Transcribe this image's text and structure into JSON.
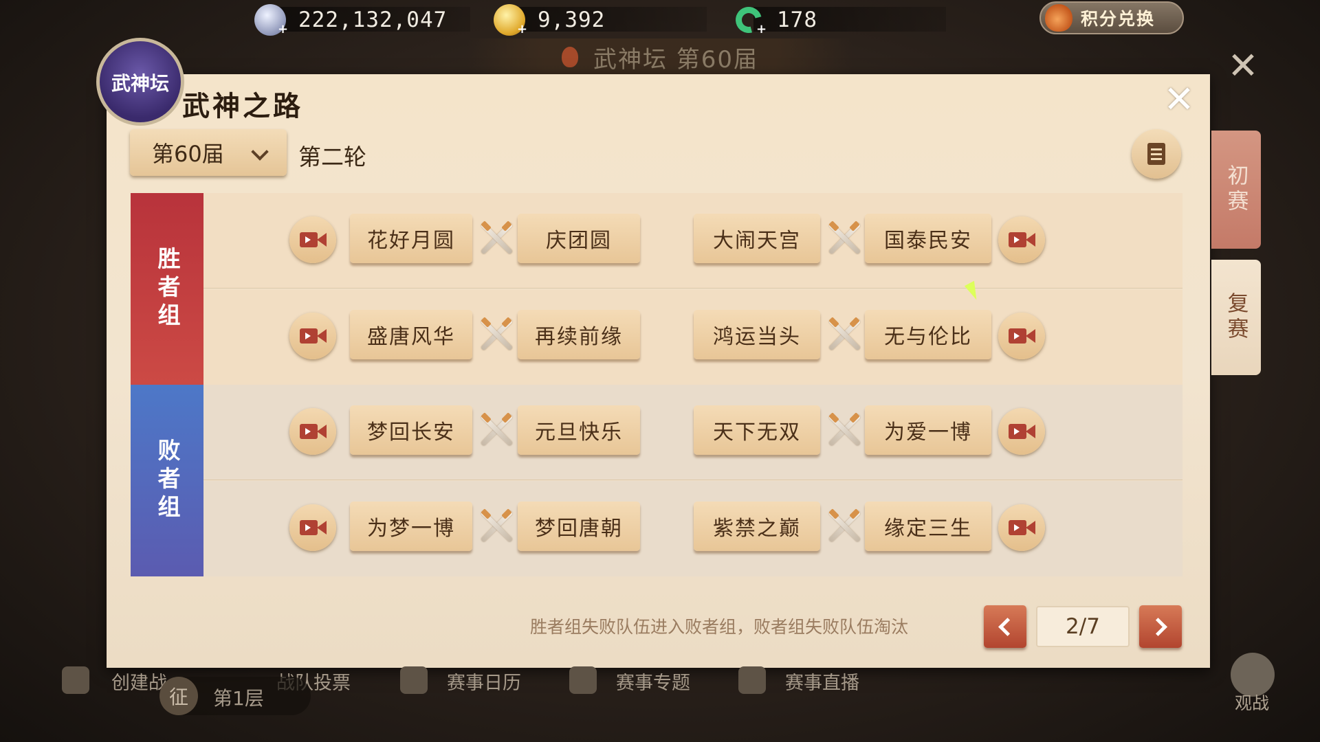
{
  "currencies": [
    {
      "icon": "silver-coin-icon",
      "value": "222,132,047"
    },
    {
      "icon": "gold-coin-icon",
      "value": "9,392"
    },
    {
      "icon": "jade-icon",
      "value": "178"
    }
  ],
  "points_exchange": "积分兑换",
  "event_subtitle": "武神坛  第60届",
  "emblem_text": "武神坛",
  "panel": {
    "title": "武神之路",
    "season": "第60届",
    "round": "第二轮"
  },
  "groups": {
    "winners": "胜者组",
    "losers": "败者组"
  },
  "matches": [
    {
      "a": "花好月圆",
      "b": "庆团圆",
      "c": "大闹天宫",
      "d": "国泰民安"
    },
    {
      "a": "盛唐风华",
      "b": "再续前缘",
      "c": "鸿运当头",
      "d": "无与伦比"
    },
    {
      "a": "梦回长安",
      "b": "元旦快乐",
      "c": "天下无双",
      "d": "为爱一博"
    },
    {
      "a": "为梦一博",
      "b": "梦回唐朝",
      "c": "紫禁之巅",
      "d": "缘定三生"
    }
  ],
  "footer_note": "胜者组失败队伍进入败者组，败者组失败队伍淘汰",
  "pagination": {
    "text": "2/7",
    "current": 2,
    "total": 7
  },
  "side_tabs": {
    "preliminary": "初赛",
    "repechage": "复赛"
  },
  "bottom_bar": {
    "create_team": "创建战",
    "team_vote": "战队投票",
    "calendar": "赛事日历",
    "topics": "赛事专题",
    "live": "赛事直播",
    "floor_badge": "征",
    "floor": "第1层",
    "watch": "观战"
  },
  "colors": {
    "winners_group": "#b8333b",
    "losers_group": "#4d78c8",
    "panel_bg": "#f2e4cf",
    "page_button": "#c05a3d"
  }
}
